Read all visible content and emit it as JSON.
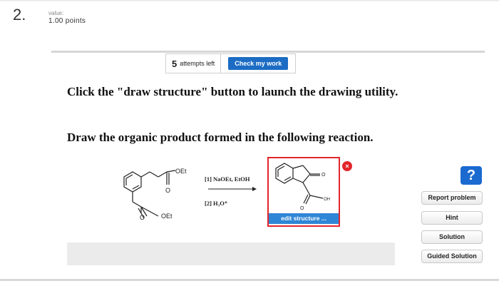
{
  "question": {
    "number": "2.",
    "value_label": "value:",
    "points": "1.00 points"
  },
  "toolbar": {
    "attempts_count": "5",
    "attempts_label": "attempts left",
    "check_label": "Check my work"
  },
  "instructions": "Click the \"draw structure\" button to launch the drawing utility.",
  "prompt": "Draw the organic product formed in the following reaction.",
  "reaction": {
    "reactant_labels": {
      "oet_top": "OEt",
      "o_ketone": "O",
      "o_ester": "O",
      "oet_bottom": "OEt"
    },
    "reagent_1": "[1] NaOEt, EtOH",
    "reagent_2": "[2] H₃O⁺",
    "product_labels": {
      "o_ring": "O",
      "oh": "OH",
      "o_acid": "O"
    }
  },
  "product_box": {
    "close_symbol": "×",
    "edit_label": "edit structure ..."
  },
  "sidebar": {
    "help_symbol": "?",
    "report_label": "Report problem",
    "hint_label": "Hint",
    "solution_label": "Solution",
    "guided_label": "Guided Solution"
  },
  "colors": {
    "accent_blue": "#1c6cc4",
    "edit_blue": "#2f86d6",
    "box_red": "#e2262c",
    "help_blue": "#1b6ad0"
  }
}
